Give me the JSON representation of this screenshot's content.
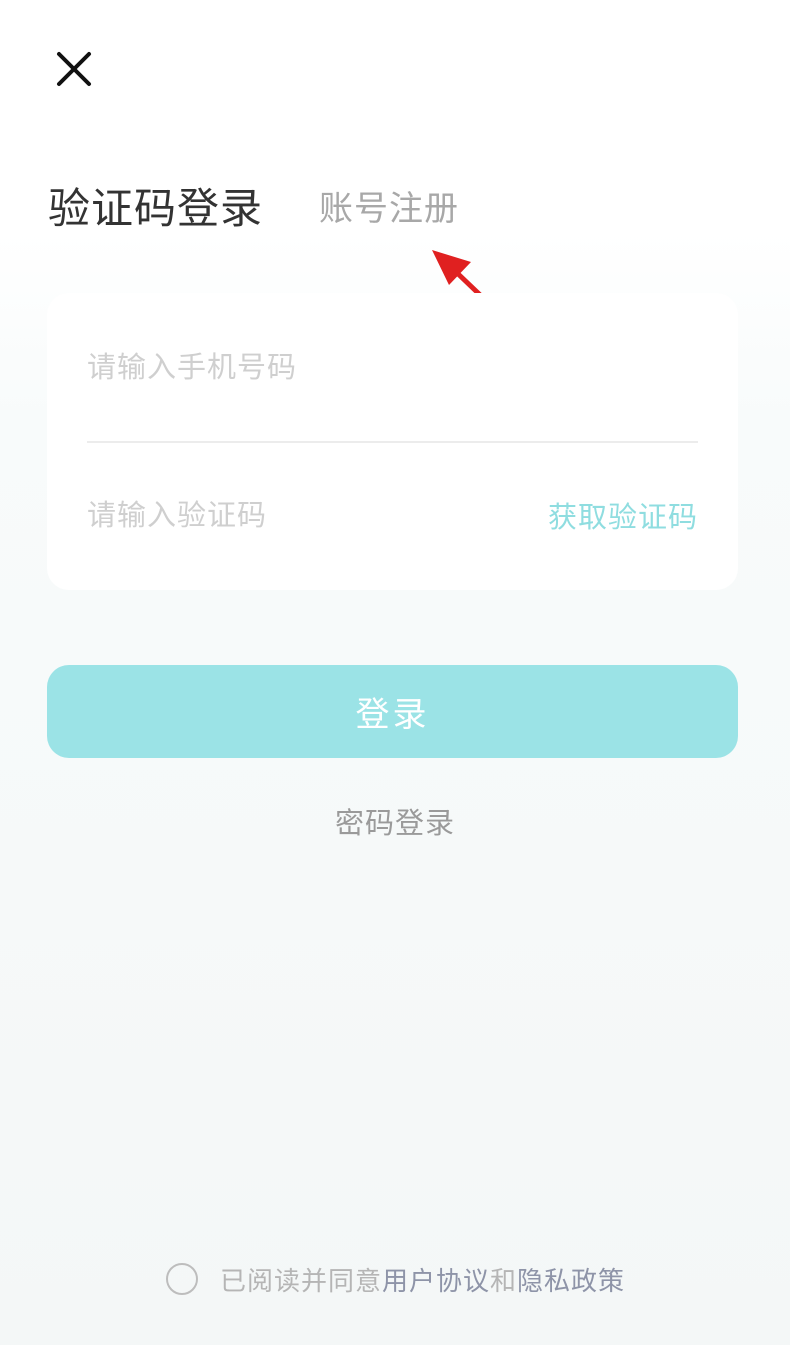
{
  "header": {
    "close_icon": "close-icon"
  },
  "tabs": {
    "active_label": "验证码登录",
    "inactive_label": "账号注册"
  },
  "form": {
    "phone_placeholder": "请输入手机号码",
    "code_placeholder": "请输入验证码",
    "get_code_label": "获取验证码"
  },
  "actions": {
    "login_label": "登录",
    "password_login_label": "密码登录"
  },
  "agreement": {
    "prefix": "已阅读并同意",
    "user_agreement": "用户协议",
    "and": "和",
    "privacy_policy": "隐私政策"
  },
  "colors": {
    "accent": "#9be3e6",
    "accent_text": "#8fdde0",
    "annotation_arrow": "#e02020"
  }
}
